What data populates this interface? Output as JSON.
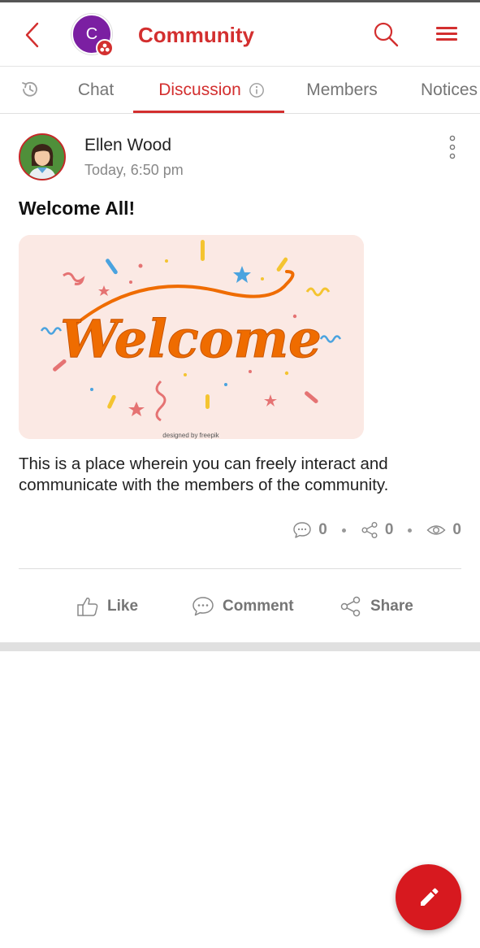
{
  "header": {
    "title": "Community",
    "avatar_initial": "C",
    "icons": {
      "back": "chevron-left-icon",
      "search": "search-icon",
      "menu": "hamburger-menu-icon",
      "badge": "community-group-badge-icon"
    }
  },
  "tabs": [
    {
      "id": "history",
      "label": "",
      "icon": "history-icon",
      "active": false
    },
    {
      "id": "chat",
      "label": "Chat",
      "active": false
    },
    {
      "id": "discussion",
      "label": "Discussion",
      "icon": "info-icon",
      "active": true
    },
    {
      "id": "members",
      "label": "Members",
      "active": false
    },
    {
      "id": "notices",
      "label": "Notices",
      "active": false
    }
  ],
  "post": {
    "author": "Ellen Wood",
    "timestamp": "Today, 6:50 pm",
    "title": "Welcome All!",
    "image": {
      "text": "Welcome",
      "credit": "designed by freepik"
    },
    "body": "This is a place wherein you can freely interact and communicate with the members of the community.",
    "stats": {
      "comments": "0",
      "shares": "0",
      "views": "0"
    },
    "actions": {
      "like": "Like",
      "comment": "Comment",
      "share": "Share"
    }
  },
  "fab": {
    "icon": "pencil-edit-icon"
  },
  "colors": {
    "accent": "#d32f2f",
    "community_avatar": "#7b1fa2",
    "fab": "#d7191f",
    "image_bg": "#fbe9e4",
    "welcome_text": "#ef6c00"
  }
}
